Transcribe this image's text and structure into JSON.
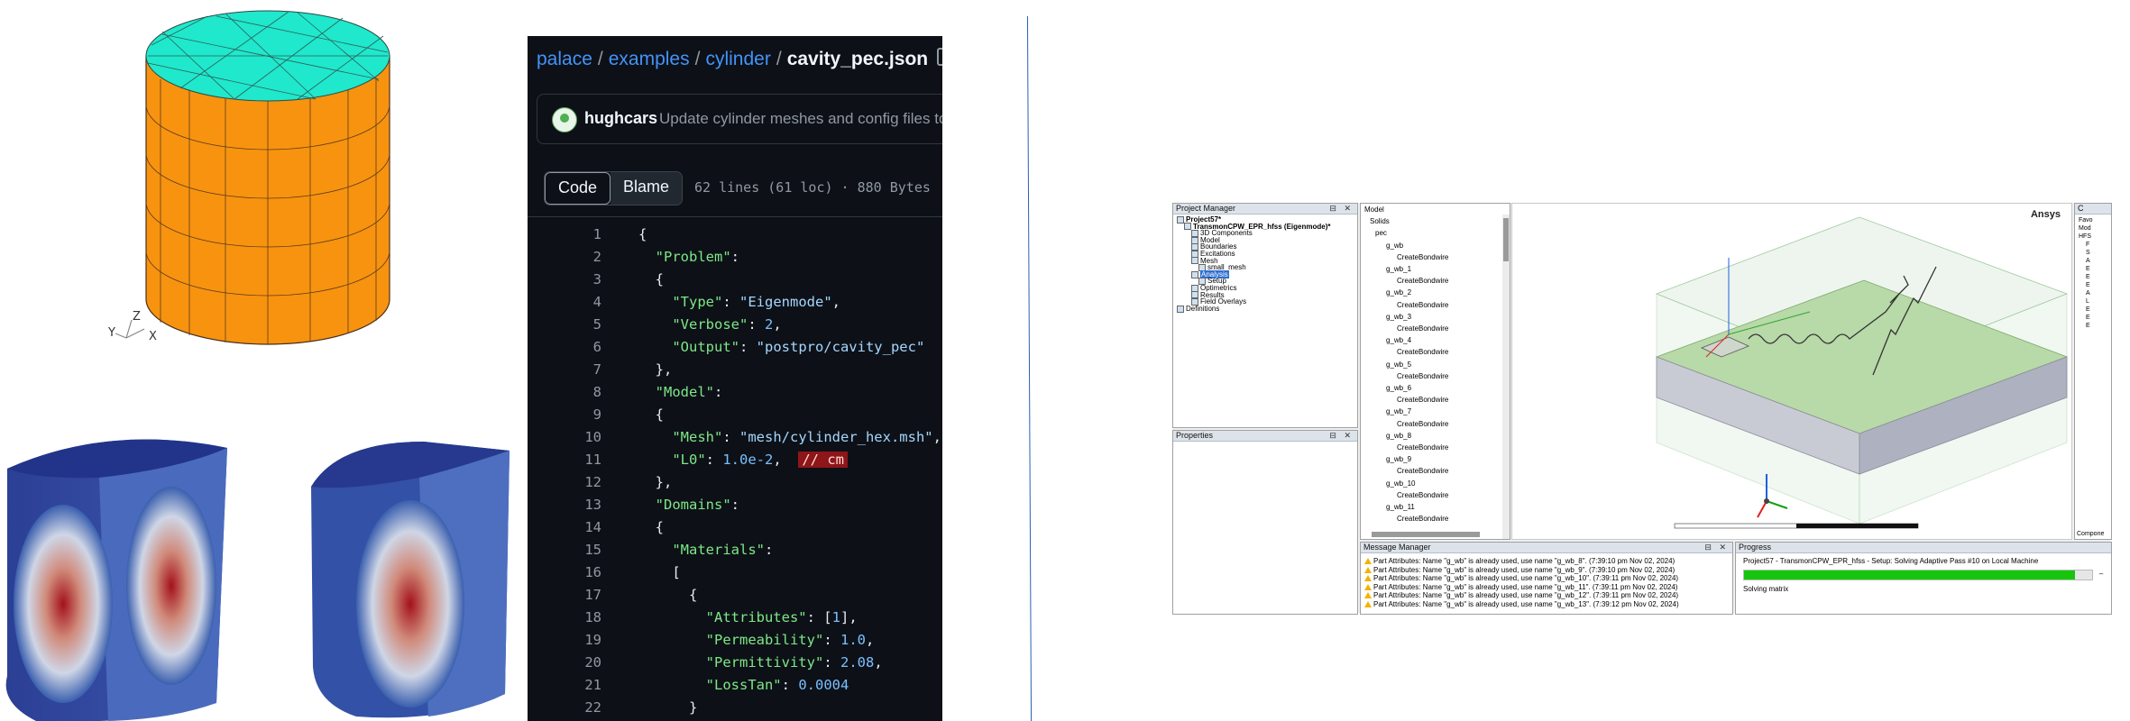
{
  "figures": {
    "axes_labels": [
      "Z",
      "Y",
      "X"
    ]
  },
  "github": {
    "breadcrumb": [
      "palace",
      "examples",
      "cylinder"
    ],
    "separator": "/",
    "file_name": "cavity_pec.json",
    "commit_author": "hughcars",
    "commit_message": "Update cylinder meshes and config files to",
    "tab_code": "Code",
    "tab_blame": "Blame",
    "file_meta": "62 lines (61 loc) · 880 Bytes",
    "code_lines": [
      {
        "n": "1",
        "parts": [
          [
            "p",
            "{"
          ]
        ]
      },
      {
        "n": "2",
        "parts": [
          [
            "p",
            "  "
          ],
          [
            "k",
            "\"Problem\""
          ],
          [
            "p",
            ":"
          ]
        ]
      },
      {
        "n": "3",
        "parts": [
          [
            "p",
            "  {"
          ]
        ]
      },
      {
        "n": "4",
        "parts": [
          [
            "p",
            "    "
          ],
          [
            "k",
            "\"Type\""
          ],
          [
            "p",
            ": "
          ],
          [
            "s",
            "\"Eigenmode\""
          ],
          [
            "p",
            ","
          ]
        ]
      },
      {
        "n": "5",
        "parts": [
          [
            "p",
            "    "
          ],
          [
            "k",
            "\"Verbose\""
          ],
          [
            "p",
            ": "
          ],
          [
            "c",
            "2"
          ],
          [
            "p",
            ","
          ]
        ]
      },
      {
        "n": "6",
        "parts": [
          [
            "p",
            "    "
          ],
          [
            "k",
            "\"Output\""
          ],
          [
            "p",
            ": "
          ],
          [
            "s",
            "\"postpro/cavity_pec\""
          ]
        ]
      },
      {
        "n": "7",
        "parts": [
          [
            "p",
            "  },"
          ]
        ]
      },
      {
        "n": "8",
        "parts": [
          [
            "p",
            "  "
          ],
          [
            "k",
            "\"Model\""
          ],
          [
            "p",
            ":"
          ]
        ]
      },
      {
        "n": "9",
        "parts": [
          [
            "p",
            "  {"
          ]
        ]
      },
      {
        "n": "10",
        "parts": [
          [
            "p",
            "    "
          ],
          [
            "k",
            "\"Mesh\""
          ],
          [
            "p",
            ": "
          ],
          [
            "s",
            "\"mesh/cylinder_hex.msh\""
          ],
          [
            "p",
            ","
          ]
        ]
      },
      {
        "n": "11",
        "parts": [
          [
            "p",
            "    "
          ],
          [
            "k",
            "\"L0\""
          ],
          [
            "p",
            ": "
          ],
          [
            "c",
            "1.0e-2"
          ],
          [
            "p",
            ",  "
          ],
          [
            "e",
            "// cm"
          ]
        ]
      },
      {
        "n": "12",
        "parts": [
          [
            "p",
            "  },"
          ]
        ]
      },
      {
        "n": "13",
        "parts": [
          [
            "p",
            "  "
          ],
          [
            "k",
            "\"Domains\""
          ],
          [
            "p",
            ":"
          ]
        ]
      },
      {
        "n": "14",
        "parts": [
          [
            "p",
            "  {"
          ]
        ]
      },
      {
        "n": "15",
        "parts": [
          [
            "p",
            "    "
          ],
          [
            "k",
            "\"Materials\""
          ],
          [
            "p",
            ":"
          ]
        ]
      },
      {
        "n": "16",
        "parts": [
          [
            "p",
            "    ["
          ]
        ]
      },
      {
        "n": "17",
        "parts": [
          [
            "p",
            "      {"
          ]
        ]
      },
      {
        "n": "18",
        "parts": [
          [
            "p",
            "        "
          ],
          [
            "k",
            "\"Attributes\""
          ],
          [
            "p",
            ": ["
          ],
          [
            "c",
            "1"
          ],
          [
            "p",
            "],"
          ]
        ]
      },
      {
        "n": "19",
        "parts": [
          [
            "p",
            "        "
          ],
          [
            "k",
            "\"Permeability\""
          ],
          [
            "p",
            ": "
          ],
          [
            "c",
            "1.0"
          ],
          [
            "p",
            ","
          ]
        ]
      },
      {
        "n": "20",
        "parts": [
          [
            "p",
            "        "
          ],
          [
            "k",
            "\"Permittivity\""
          ],
          [
            "p",
            ": "
          ],
          [
            "c",
            "2.08"
          ],
          [
            "p",
            ","
          ]
        ]
      },
      {
        "n": "21",
        "parts": [
          [
            "p",
            "        "
          ],
          [
            "k",
            "\"LossTan\""
          ],
          [
            "p",
            ": "
          ],
          [
            "c",
            "0.0004"
          ]
        ]
      },
      {
        "n": "22",
        "parts": [
          [
            "p",
            "      }"
          ]
        ]
      }
    ]
  },
  "ansys": {
    "project_manager": {
      "title": "Project Manager",
      "items": [
        {
          "label": "Project57*",
          "bold": true
        },
        {
          "label": "TransmonCPW_EPR_hfss (Eigenmode)*",
          "bold": true
        },
        {
          "label": "3D Components"
        },
        {
          "label": "Model"
        },
        {
          "label": "Boundaries"
        },
        {
          "label": "Excitations"
        },
        {
          "label": "Mesh"
        },
        {
          "label": "small_mesh"
        },
        {
          "label": "Analysis",
          "selected": true
        },
        {
          "label": "Setup"
        },
        {
          "label": "Optimetrics"
        },
        {
          "label": "Results"
        },
        {
          "label": "Field Overlays"
        },
        {
          "label": "Definitions"
        }
      ]
    },
    "properties": {
      "title": "Properties"
    },
    "model_tree": {
      "items": [
        "Model",
        "Solids",
        "pec",
        "g_wb",
        "CreateBondwire",
        "g_wb_1",
        "CreateBondwire",
        "g_wb_2",
        "CreateBondwire",
        "g_wb_3",
        "CreateBondwire",
        "g_wb_4",
        "CreateBondwire",
        "g_wb_5",
        "CreateBondwire",
        "g_wb_6",
        "CreateBondwire",
        "g_wb_7",
        "CreateBondwire",
        "g_wb_8",
        "CreateBondwire",
        "g_wb_9",
        "CreateBondwire",
        "g_wb_10",
        "CreateBondwire",
        "g_wb_11",
        "CreateBondwire"
      ]
    },
    "viewport": {
      "brand": "Ansys"
    },
    "right_tree": {
      "header": "C",
      "items": [
        "Favo",
        "Mod",
        "HFS",
        "F",
        "S",
        "A",
        "E",
        "E",
        "E",
        "A",
        "L",
        "E",
        "E",
        "E"
      ],
      "footer": "Compone"
    },
    "message_manager": {
      "title": "Message Manager",
      "rows": [
        "Part Attributes: Name \"g_wb\" is already used, use name \"g_wb_8\". (7:39:10 pm  Nov 02, 2024)",
        "Part Attributes: Name \"g_wb\" is already used, use name \"g_wb_9\". (7:39:10 pm  Nov 02, 2024)",
        "Part Attributes: Name \"g_wb\" is already used, use name \"g_wb_10\". (7:39:11 pm  Nov 02, 2024)",
        "Part Attributes: Name \"g_wb\" is already used, use name \"g_wb_11\". (7:39:11 pm  Nov 02, 2024)",
        "Part Attributes: Name \"g_wb\" is already used, use name \"g_wb_12\". (7:39:11 pm  Nov 02, 2024)",
        "Part Attributes: Name \"g_wb\" is already used, use name \"g_wb_13\". (7:39:12 pm  Nov 02, 2024)"
      ]
    },
    "progress": {
      "title": "Progress",
      "status": "Project57 - TransmonCPW_EPR_hfss - Setup: Solving Adaptive Pass #10  on Local Machine",
      "detail": "Solving matrix",
      "fraction": 0.95,
      "bar_color": "#16c60c"
    }
  }
}
